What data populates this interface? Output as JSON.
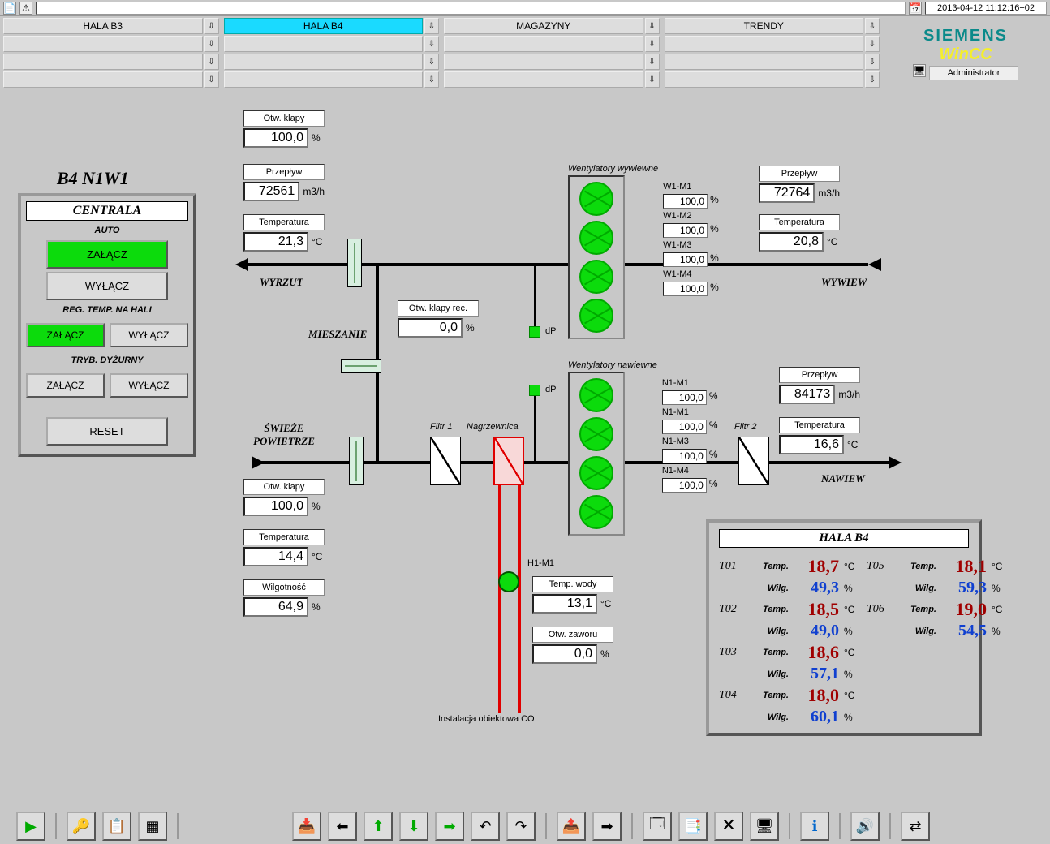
{
  "timestamp": "2013-04-12 11:12:16+02",
  "nav": {
    "tabs": [
      "HALA B3",
      "HALA B4",
      "MAGAZYNY",
      "TRENDY"
    ],
    "active_index": 1
  },
  "brand": {
    "line1": "SIEMENS",
    "line2": "WinCC"
  },
  "user": "Administrator",
  "page_title": "B4 N1W1",
  "panel": {
    "title": "CENTRALA",
    "mode": "AUTO",
    "btn_on": "ZAŁĄCZ",
    "btn_off": "WYŁĄCZ",
    "section_reg": "REG. TEMP. NA HALI",
    "section_duty": "TRYB. DYŻURNY",
    "btn_reset": "RESET"
  },
  "exhaust_top": {
    "damper_label": "Otw. klapy",
    "damper_val": "100,0",
    "damper_unit": "%",
    "flow_label": "Przepływ",
    "flow_val": "72561",
    "flow_unit": "m3/h",
    "temp_label": "Temperatura",
    "temp_val": "21,3",
    "temp_unit": "°C"
  },
  "recirc": {
    "label": "Otw. klapy rec.",
    "val": "0,0",
    "unit": "%"
  },
  "supply_bottom": {
    "damper_label": "Otw. klapy",
    "damper_val": "100,0",
    "damper_unit": "%",
    "temp_label": "Temperatura",
    "temp_val": "14,4",
    "temp_unit": "°C",
    "humid_label": "Wilgotność",
    "humid_val": "64,9",
    "humid_unit": "%"
  },
  "exhaust_right": {
    "flow_label": "Przepływ",
    "flow_val": "72764",
    "flow_unit": "m3/h",
    "temp_label": "Temperatura",
    "temp_val": "20,8",
    "temp_unit": "°C"
  },
  "supply_right": {
    "flow_label": "Przepływ",
    "flow_val": "84173",
    "flow_unit": "m3/h",
    "temp_label": "Temperatura",
    "temp_val": "16,6",
    "temp_unit": "°C"
  },
  "labels": {
    "wyrzut": "WYRZUT",
    "mieszanie": "MIESZANIE",
    "swieze": "ŚWIEŻE POWIETRZE",
    "wywiew": "WYWIEW",
    "nawiew": "NAWIEW",
    "filtr1": "Filtr 1",
    "filtr2": "Filtr 2",
    "nagrzewnica": "Nagrzewnica",
    "fans_exhaust": "Wentylatory wywiewne",
    "fans_supply": "Wentylatory nawiewne",
    "dp": "dP",
    "h1m1": "H1-M1",
    "co_install": "Instalacja obiektowa CO"
  },
  "heater": {
    "water_label": "Temp. wody",
    "water_val": "13,1",
    "water_unit": "°C",
    "valve_label": "Otw. zaworu",
    "valve_val": "0,0",
    "valve_unit": "%"
  },
  "fans_ex": [
    {
      "id": "W1-M1",
      "val": "100,0",
      "unit": "%"
    },
    {
      "id": "W1-M2",
      "val": "100,0",
      "unit": "%"
    },
    {
      "id": "W1-M3",
      "val": "100,0",
      "unit": "%"
    },
    {
      "id": "W1-M4",
      "val": "100,0",
      "unit": "%"
    }
  ],
  "fans_su": [
    {
      "id": "N1-M1",
      "val": "100,0",
      "unit": "%"
    },
    {
      "id": "N1-M1",
      "val": "100,0",
      "unit": "%"
    },
    {
      "id": "N1-M3",
      "val": "100,0",
      "unit": "%"
    },
    {
      "id": "N1-M4",
      "val": "100,0",
      "unit": "%"
    }
  ],
  "hall": {
    "title": "HALA B4",
    "labels": {
      "temp": "Temp.",
      "humid": "Wilg.",
      "tempu": "°C",
      "humu": "%"
    },
    "readings": [
      {
        "id": "T01",
        "temp": "18,7",
        "humid": "49,3"
      },
      {
        "id": "T02",
        "temp": "18,5",
        "humid": "49,0"
      },
      {
        "id": "T03",
        "temp": "18,6",
        "humid": "57,1"
      },
      {
        "id": "T04",
        "temp": "18,0",
        "humid": "60,1"
      },
      {
        "id": "T05",
        "temp": "18,1",
        "humid": "59,3"
      },
      {
        "id": "T06",
        "temp": "19,0",
        "humid": "54,5"
      }
    ]
  }
}
